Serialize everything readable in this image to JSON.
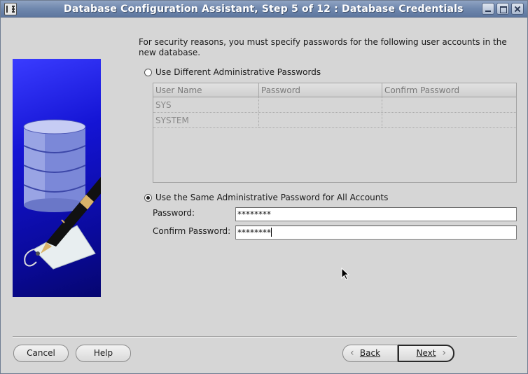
{
  "window": {
    "title": "Database Configuration Assistant, Step 5 of 12 : Database Credentials"
  },
  "intro_text": "For security reasons, you must specify passwords for the following user accounts in the new database.",
  "options": {
    "different": {
      "label": "Use Different Administrative Passwords",
      "selected": false
    },
    "same": {
      "label": "Use the Same Administrative Password for All Accounts",
      "selected": true
    }
  },
  "accounts_table": {
    "columns": [
      "User Name",
      "Password",
      "Confirm Password"
    ],
    "rows": [
      [
        "SYS",
        "",
        ""
      ],
      [
        "SYSTEM",
        "",
        ""
      ]
    ]
  },
  "password": {
    "label": "Password:",
    "value": "********"
  },
  "confirm_password": {
    "label": "Confirm Password:",
    "value": "********"
  },
  "buttons": {
    "cancel": "Cancel",
    "help": "Help",
    "back": "Back",
    "next": "Next"
  },
  "colors": {
    "titlebar": "#6f87ad",
    "background": "#d6d6d6",
    "side_image": "#1414d4"
  },
  "icons": [
    "app-icon",
    "minimize-icon",
    "maximize-icon",
    "close-icon",
    "database-cylinder-icon",
    "pen-icon",
    "tag-icon",
    "mouse-pointer-icon"
  ]
}
